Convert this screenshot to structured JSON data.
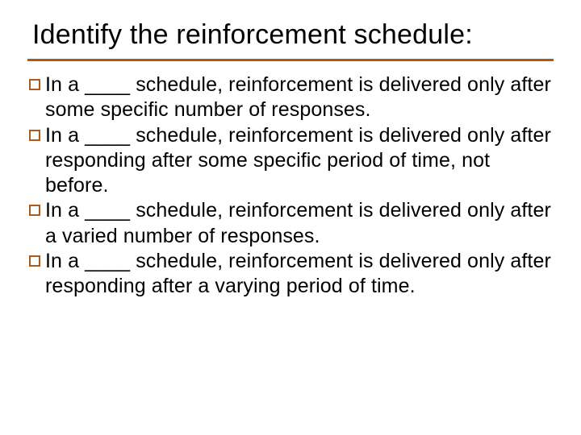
{
  "slide": {
    "title": "Identify the reinforcement schedule:",
    "bullets": [
      "In a ____ schedule, reinforcement is delivered only after some specific number of responses.",
      "In a ____ schedule, reinforcement is delivered only after responding after some specific period of time, not before.",
      "In a ____ schedule, reinforcement is delivered only after a varied number of responses.",
      "In a ____ schedule, reinforcement is delivered only after responding after a varying period of time."
    ]
  }
}
